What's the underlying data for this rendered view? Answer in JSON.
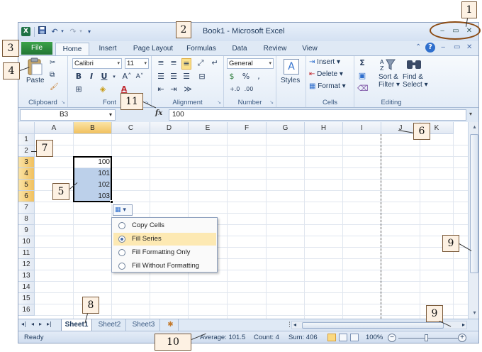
{
  "titlebar": {
    "app_title": "Book1  -  Microsoft Excel",
    "qat": {
      "undo": "↶",
      "redo": "↷"
    }
  },
  "tabs": {
    "file": "File",
    "items": [
      "Home",
      "Insert",
      "Page Layout",
      "Formulas",
      "Data",
      "Review",
      "View"
    ],
    "active": "Home"
  },
  "ribbon": {
    "clipboard": {
      "label": "Clipboard",
      "paste": "Paste"
    },
    "font": {
      "label": "Font",
      "name": "Calibri",
      "size": "11",
      "bold": "B",
      "italic": "I",
      "underline": "U"
    },
    "alignment": {
      "label": "Alignment"
    },
    "number": {
      "label": "Number",
      "format": "General",
      "percent": "%",
      "comma": ","
    },
    "styles": {
      "label": "Styles"
    },
    "cells": {
      "label": "Cells",
      "insert": "Insert",
      "delete": "Delete",
      "format": "Format"
    },
    "editing": {
      "label": "Editing",
      "sort_filter_line1": "Sort &",
      "sort_filter_line2": "Filter",
      "find_select_line1": "Find &",
      "find_select_line2": "Select"
    }
  },
  "formula_bar": {
    "name_box": "B3",
    "fx": "fx",
    "content": "100"
  },
  "grid": {
    "columns": [
      "A",
      "B",
      "C",
      "D",
      "E",
      "F",
      "G",
      "H",
      "I",
      "J",
      "K"
    ],
    "rows": [
      "1",
      "2",
      "3",
      "4",
      "5",
      "6",
      "7",
      "8",
      "9",
      "10",
      "11",
      "12",
      "13",
      "14",
      "15",
      "16"
    ],
    "selected_column": "B",
    "values": [
      {
        "row": "3",
        "value": "100"
      },
      {
        "row": "4",
        "value": "101"
      },
      {
        "row": "5",
        "value": "102"
      },
      {
        "row": "6",
        "value": "103"
      }
    ]
  },
  "autofill_menu": {
    "button": "▾",
    "items": [
      {
        "label": "Copy Cells",
        "checked": false
      },
      {
        "label": "Fill Series",
        "checked": true
      },
      {
        "label": "Fill Formatting Only",
        "checked": false
      },
      {
        "label": "Fill Without Formatting",
        "checked": false
      }
    ]
  },
  "sheets": {
    "tabs": [
      "Sheet1",
      "Sheet2",
      "Sheet3"
    ],
    "active": "Sheet1"
  },
  "statusbar": {
    "ready": "Ready",
    "average": "Average: 101.5",
    "count": "Count: 4",
    "sum": "Sum: 406",
    "zoom": "100%"
  },
  "callouts": [
    "1",
    "2",
    "3",
    "4",
    "5",
    "6",
    "7",
    "8",
    "9",
    "9",
    "10",
    "11"
  ],
  "colors": {
    "file_tab": "#217534",
    "selection": "#bcd0ea",
    "header_selected": "#f1c15f",
    "callout_fill": "#fdf1e3",
    "oval": "#8b4a12"
  }
}
